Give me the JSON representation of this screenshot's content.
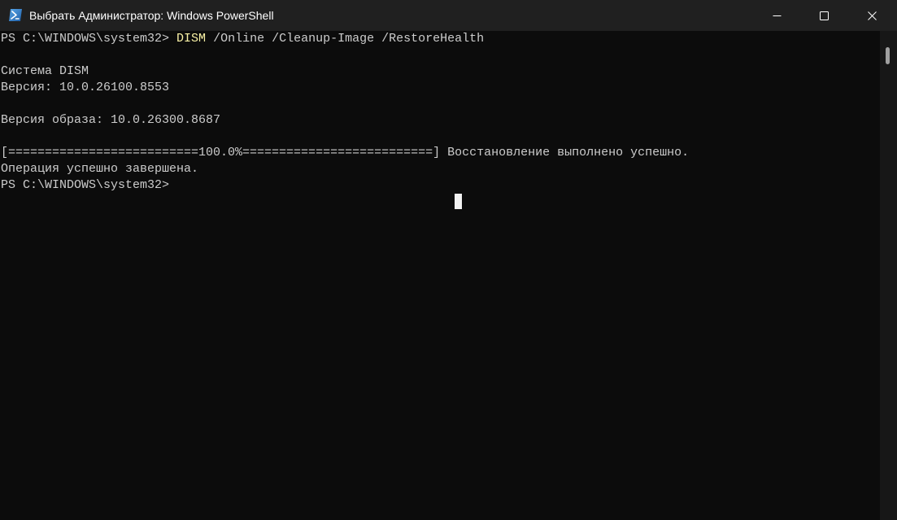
{
  "window": {
    "title": "Выбрать Администратор: Windows PowerShell",
    "app_icon": "powershell-icon",
    "controls": {
      "minimize_icon": "minimize-icon",
      "maximize_icon": "maximize-icon",
      "close_icon": "close-icon"
    }
  },
  "terminal": {
    "prompt1": "PS C:\\WINDOWS\\system32> ",
    "command_keyword": "DISM",
    "command_args": " /Online /Cleanup-Image /RestoreHealth",
    "line_system": "Система DISM",
    "line_version": "Версия: 10.0.26100.8553",
    "line_image_version": "Версия образа: 10.0.26300.8687",
    "line_progress": "[==========================100.0%==========================] Восстановление выполнено успешно.",
    "line_complete": "Операция успешно завершена.",
    "prompt2": "PS C:\\WINDOWS\\system32>"
  },
  "colors": {
    "background": "#0c0c0c",
    "titlebar": "#202020",
    "text": "#cccccc",
    "command_keyword": "#f9f1a5"
  }
}
